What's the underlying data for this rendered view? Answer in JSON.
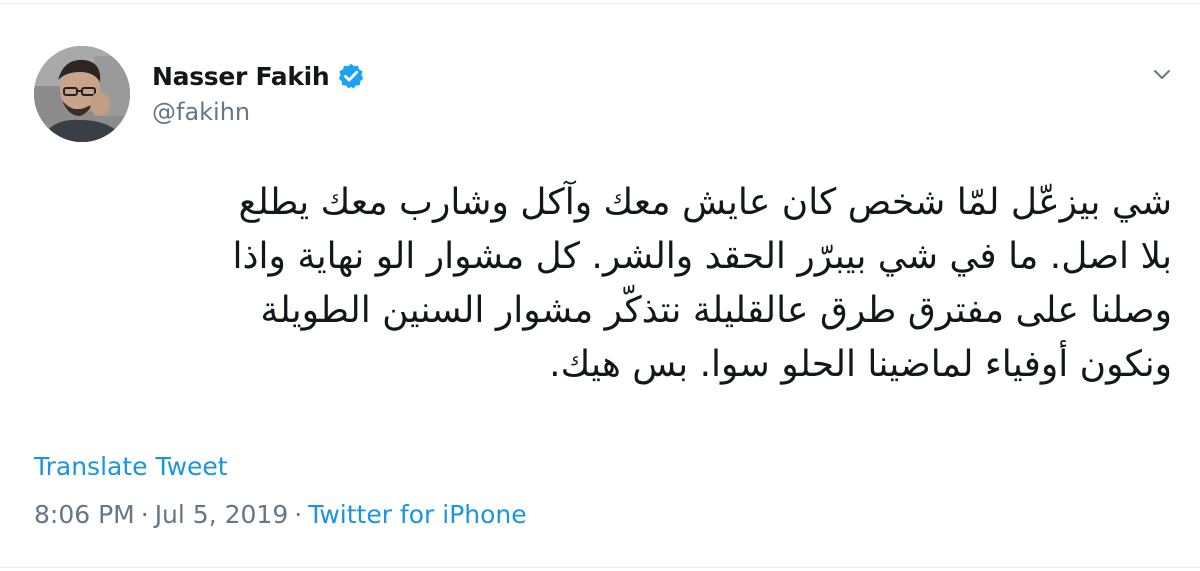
{
  "author": {
    "display_name": "Nasser Fakih",
    "handle": "@fakihn",
    "verified": true
  },
  "tweet": {
    "lines": [
      "شي بيزعّل لمّا شخص كان عايش معك وآكل وشارب معك يطلع",
      "بلا اصل. ما في شي بيبرّر الحقد والشر. كل مشوار الو نهاية واذا",
      "وصلنا على مفترق طرق عالقليلة نتذكّر مشوار السنين الطويلة",
      "ونكون أوفياء لماضينا الحلو سوا. بس هيك."
    ]
  },
  "translate_label": "Translate Tweet",
  "meta": {
    "time": "8:06 PM",
    "separator": "·",
    "date": "Jul 5, 2019",
    "source": "Twitter for iPhone"
  },
  "icons": {
    "verified": "verified-badge-icon",
    "caret": "chevron-down-icon"
  },
  "colors": {
    "accent": "#1b95e0",
    "verified": "#1da1f2",
    "text": "#14171a",
    "secondary": "#657786"
  }
}
